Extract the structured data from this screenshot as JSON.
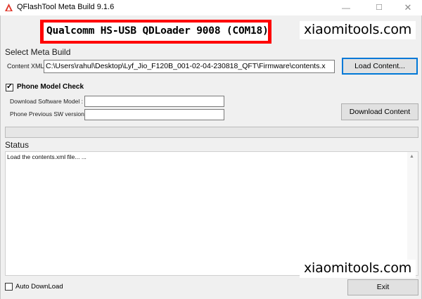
{
  "window": {
    "title": "QFlashTool Meta Build 9.1.6",
    "minimize_glyph": "—",
    "maximize_glyph": "☐",
    "close_glyph": "✕"
  },
  "port_banner": "Qualcomm HS-USB QDLoader 9008 (COM18)",
  "watermark": "xiaomitools.com",
  "meta_build": {
    "section_label": "Select Meta Build",
    "content_xml_label": "Content XML",
    "content_xml_value": "C:\\Users\\rahul\\Desktop\\Lyf_Jio_F120B_001-02-04-230818_QFT\\Firmware\\contents.x",
    "load_button": "Load Content..."
  },
  "phone_model_check": {
    "label": "Phone Model Check",
    "checked": true,
    "check_glyph": "✓",
    "download_model_label": "Download Software  Model :",
    "download_model_value": "",
    "previous_sw_label": "Phone Previous  SW version",
    "previous_sw_value": ""
  },
  "download_button": "Download Content",
  "status": {
    "label": "Status",
    "text": "Load the contents.xml file... ...",
    "scroll_up_glyph": "▲",
    "scroll_down_glyph": "▼"
  },
  "auto_download": {
    "label": "Auto DownLoad",
    "checked": false
  },
  "exit_button": "Exit",
  "colors": {
    "banner_red": "#ff0000",
    "focus_blue": "#0078d7",
    "window_bg": "#f0f0f0"
  },
  "icons": {
    "app": "qflashtool-app-icon"
  }
}
